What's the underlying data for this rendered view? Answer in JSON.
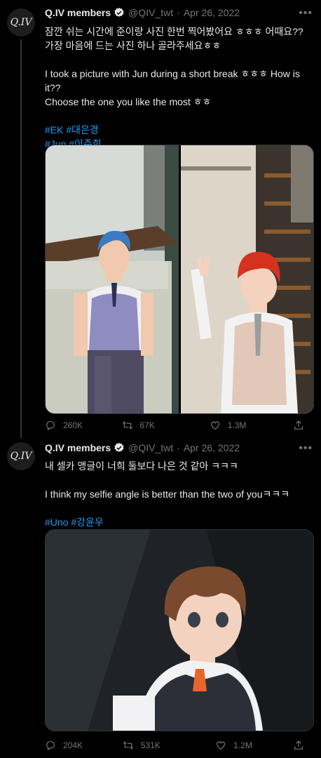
{
  "tweets": [
    {
      "avatar_text": "Q.IV",
      "name": "Q.IV members",
      "handle": "@QIV_twt",
      "separator": "·",
      "date": "Apr 26, 2022",
      "lines": [
        "잠깐 쉬는 시간에 준이랑 사진 한번 찍어봤어요 ㅎㅎㅎ 어때요??",
        "가장 마음에 드는 사진 하나 골라주세요ㅎㅎ",
        "",
        "I took a picture with Jun during a short break ㅎㅎㅎ How is it??",
        "Choose the one you like the most ㅎㅎ",
        ""
      ],
      "hashtags": [
        [
          "#EK",
          "#대은경"
        ],
        [
          "#Jun",
          "#이준희"
        ]
      ],
      "stats": {
        "replies": "260K",
        "retweets": "67K",
        "likes": "1.3M"
      }
    },
    {
      "avatar_text": "Q.IV",
      "name": "Q.IV members",
      "handle": "@QIV_twt",
      "separator": "·",
      "date": "Apr 26, 2022",
      "lines": [
        "내 셀카 앵글이 너희 둘보다 나은 것 같아 ㅋㅋㅋ",
        "",
        "I think my selfie angle is better than the two of youㅋㅋㅋ",
        ""
      ],
      "hashtags": [
        [
          "#Uno",
          "#강윤우"
        ]
      ],
      "stats": {
        "replies": "204K",
        "retweets": "531K",
        "likes": "1.2M"
      }
    }
  ],
  "colors": {
    "accent": "#1d9bf0",
    "muted": "#71767b",
    "text": "#e7e9ea",
    "background": "#000000"
  },
  "icons": [
    "more-icon",
    "verified-icon",
    "reply-icon",
    "retweet-icon",
    "like-icon",
    "share-icon"
  ]
}
